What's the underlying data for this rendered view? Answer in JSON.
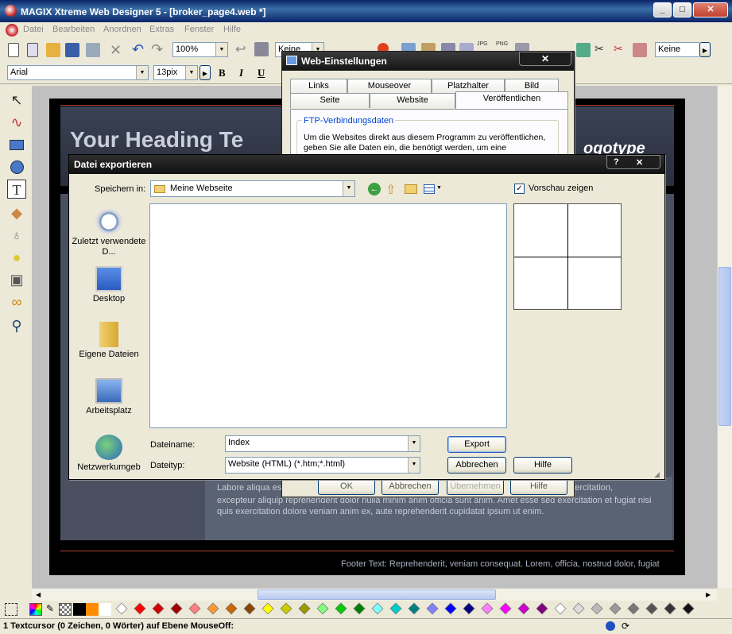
{
  "window": {
    "title": "MAGIX Xtreme Web Designer 5 - [broker_page4.web *]"
  },
  "menu": [
    "Datei",
    "Bearbeiten",
    "Anordnen",
    "Extras",
    "Fenster",
    "Hilfe"
  ],
  "toolbar": {
    "zoom": "100%",
    "layer_select": "Keine",
    "right_select": "Keine",
    "font": "Arial",
    "size": "13pix",
    "bold": "B",
    "italic": "I",
    "underline": "U"
  },
  "page": {
    "heading": "Your Heading Te",
    "logo": "ogotype",
    "body_text": [
      "Labore aliqua es",
      "sse ea. Exercitation,",
      "excepteur aliquip reprehenderit dolor nulla minim anim officia sunt anim. Amet esse sed exercitation et fugiat nisi",
      "quis exercitation dolore veniam anim ex, aute reprehenderit cupidatat ipsum ut enim."
    ],
    "footer": "Footer Text: Reprehenderit, veniam consequat. Lorem, officia, nostrud dolor, fugiat"
  },
  "web_settings": {
    "title": "Web-Einstellungen",
    "tabs_row1": [
      "Links",
      "Mouseover",
      "Platzhalter",
      "Bild"
    ],
    "tabs_row2": [
      "Seite",
      "Website",
      "Veröffentlichen"
    ],
    "group_title": "FTP-Verbindungsdaten",
    "description": [
      "Um die Websites direkt aus diesem Programm zu veröffentlichen,",
      "geben Sie alle Daten ein, die benötigt werden, um eine"
    ],
    "buttons": [
      "OK",
      "Abbrechen",
      "Übernehmen",
      "Hilfe"
    ]
  },
  "export_dialog": {
    "title": "Datei exportieren",
    "save_in_label": "Speichern in:",
    "save_in_value": "Meine Webseite",
    "preview_label": "Vorschau zeigen",
    "places": [
      "Zuletzt verwendete D...",
      "Desktop",
      "Eigene Dateien",
      "Arbeitsplatz",
      "Netzwerkumgeb"
    ],
    "filename_label": "Dateiname:",
    "filename_value": "Index",
    "filetype_label": "Dateityp:",
    "filetype_value": "Website (HTML) (*.htm;*.html)",
    "export_btn": "Export",
    "cancel_btn": "Abbrechen",
    "help_btn": "Hilfe",
    "help_q": "?",
    "close_x": "✕"
  },
  "status": {
    "text": "1 Textcursor (0 Zeichen, 0 Wörter) auf Ebene MouseOff:"
  },
  "palette": [
    "#ffffff",
    "#ff0000",
    "#d40000",
    "#a00000",
    "#ff8080",
    "#ff9933",
    "#cc6600",
    "#884400",
    "#ffff00",
    "#cccc00",
    "#999900",
    "#80ff80",
    "#00cc00",
    "#008000",
    "#80ffff",
    "#00cccc",
    "#008080",
    "#8080ff",
    "#0000ff",
    "#000080",
    "#ff80ff",
    "#ff00ff",
    "#cc00cc",
    "#800080",
    "#ffffff",
    "#dddddd",
    "#bbbbbb",
    "#999999",
    "#777777",
    "#555555",
    "#333333",
    "#111111"
  ]
}
